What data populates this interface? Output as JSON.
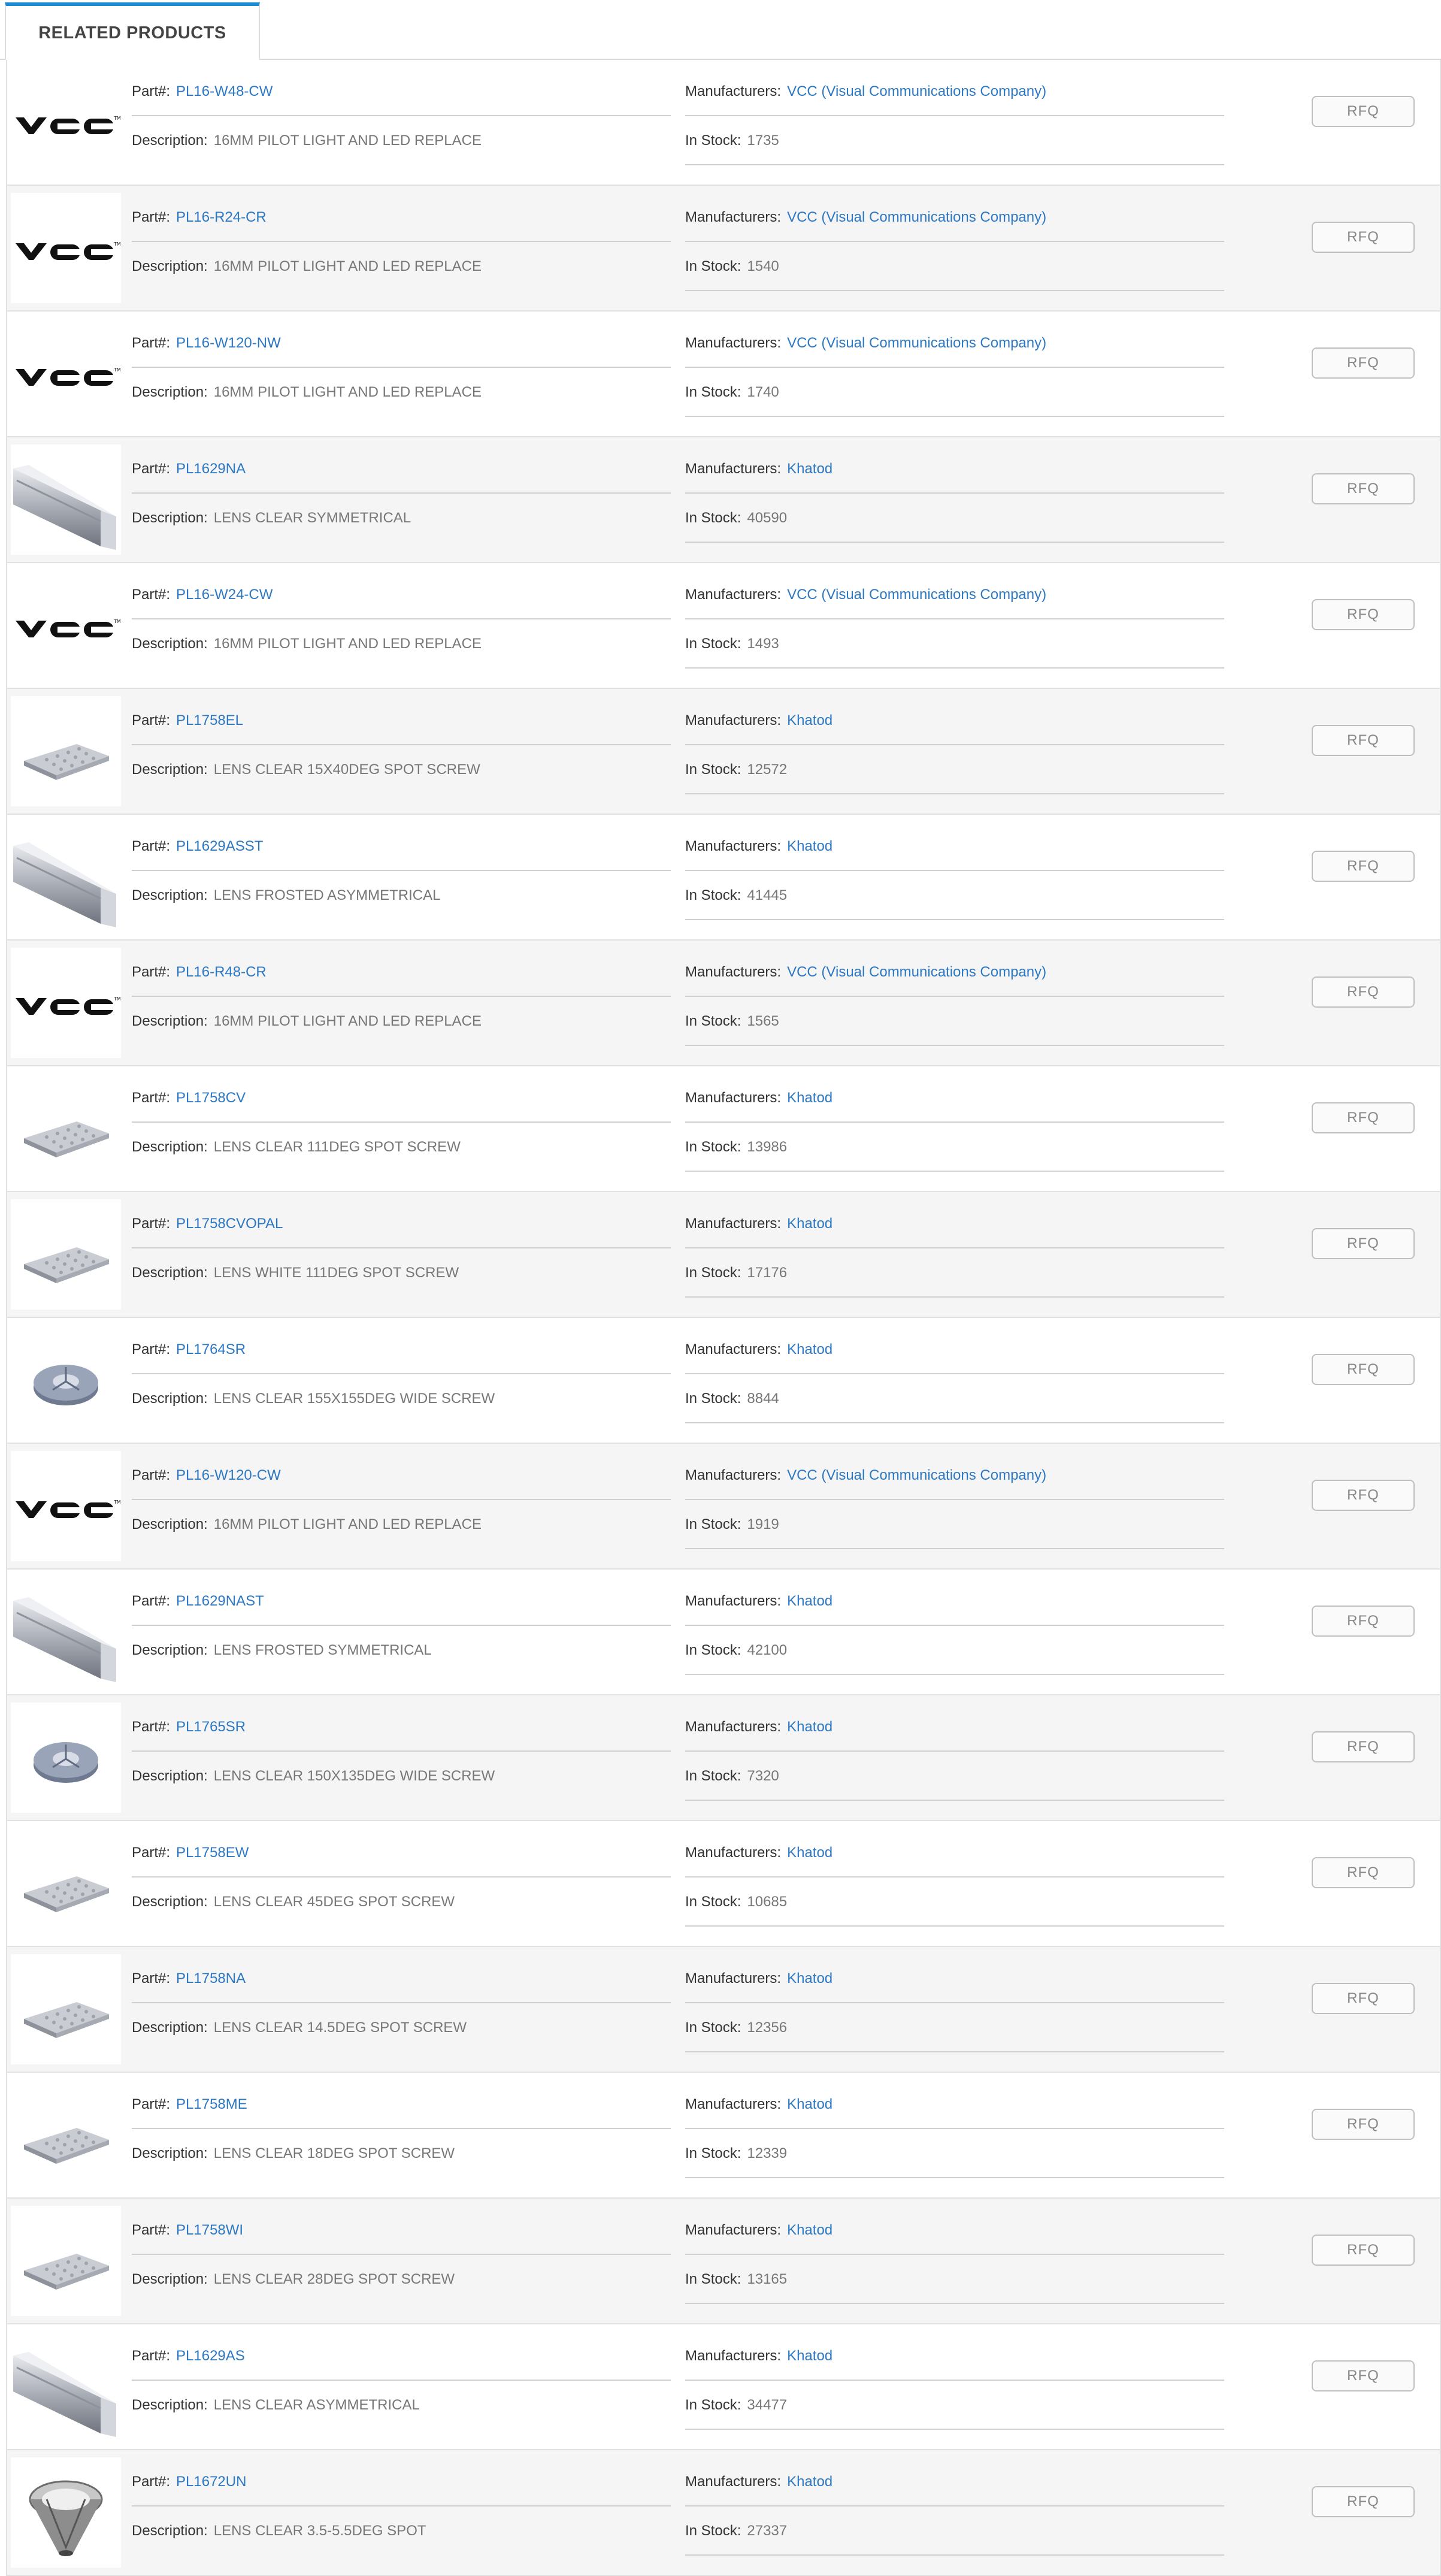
{
  "tab": {
    "label": "RELATED PRODUCTS"
  },
  "labels": {
    "part": "Part#:",
    "description": "Description:",
    "manufacturers": "Manufacturers:",
    "in_stock": "In Stock:",
    "rfq": "RFQ"
  },
  "products": [
    {
      "part": "PL16-W48-CW",
      "description": "16MM PILOT LIGHT AND LED REPLACE",
      "manufacturer": "VCC (Visual Communications Company)",
      "stock": "1735",
      "image": "vcc-logo"
    },
    {
      "part": "PL16-R24-CR",
      "description": "16MM PILOT LIGHT AND LED REPLACE",
      "manufacturer": "VCC (Visual Communications Company)",
      "stock": "1540",
      "image": "vcc-logo"
    },
    {
      "part": "PL16-W120-NW",
      "description": "16MM PILOT LIGHT AND LED REPLACE",
      "manufacturer": "VCC (Visual Communications Company)",
      "stock": "1740",
      "image": "vcc-logo"
    },
    {
      "part": "PL1629NA",
      "description": "LENS CLEAR SYMMETRICAL",
      "manufacturer": "Khatod",
      "stock": "40590",
      "image": "profile"
    },
    {
      "part": "PL16-W24-CW",
      "description": "16MM PILOT LIGHT AND LED REPLACE",
      "manufacturer": "VCC (Visual Communications Company)",
      "stock": "1493",
      "image": "vcc-logo"
    },
    {
      "part": "PL1758EL",
      "description": "LENS CLEAR 15X40DEG SPOT SCREW",
      "manufacturer": "Khatod",
      "stock": "12572",
      "image": "panel"
    },
    {
      "part": "PL1629ASST",
      "description": "LENS FROSTED ASYMMETRICAL",
      "manufacturer": "Khatod",
      "stock": "41445",
      "image": "profile"
    },
    {
      "part": "PL16-R48-CR",
      "description": "16MM PILOT LIGHT AND LED REPLACE",
      "manufacturer": "VCC (Visual Communications Company)",
      "stock": "1565",
      "image": "vcc-logo"
    },
    {
      "part": "PL1758CV",
      "description": "LENS CLEAR 111DEG SPOT SCREW",
      "manufacturer": "Khatod",
      "stock": "13986",
      "image": "panel"
    },
    {
      "part": "PL1758CVOPAL",
      "description": "LENS WHITE 111DEG SPOT SCREW",
      "manufacturer": "Khatod",
      "stock": "17176",
      "image": "panel"
    },
    {
      "part": "PL1764SR",
      "description": "LENS CLEAR 155X155DEG WIDE SCREW",
      "manufacturer": "Khatod",
      "stock": "8844",
      "image": "round-lens"
    },
    {
      "part": "PL16-W120-CW",
      "description": "16MM PILOT LIGHT AND LED REPLACE",
      "manufacturer": "VCC (Visual Communications Company)",
      "stock": "1919",
      "image": "vcc-logo"
    },
    {
      "part": "PL1629NAST",
      "description": "LENS FROSTED SYMMETRICAL",
      "manufacturer": "Khatod",
      "stock": "42100",
      "image": "profile"
    },
    {
      "part": "PL1765SR",
      "description": "LENS CLEAR 150X135DEG WIDE SCREW",
      "manufacturer": "Khatod",
      "stock": "7320",
      "image": "round-lens"
    },
    {
      "part": "PL1758EW",
      "description": "LENS CLEAR 45DEG SPOT SCREW",
      "manufacturer": "Khatod",
      "stock": "10685",
      "image": "panel"
    },
    {
      "part": "PL1758NA",
      "description": "LENS CLEAR 14.5DEG SPOT SCREW",
      "manufacturer": "Khatod",
      "stock": "12356",
      "image": "panel"
    },
    {
      "part": "PL1758ME",
      "description": "LENS CLEAR 18DEG SPOT SCREW",
      "manufacturer": "Khatod",
      "stock": "12339",
      "image": "panel"
    },
    {
      "part": "PL1758WI",
      "description": "LENS CLEAR 28DEG SPOT SCREW",
      "manufacturer": "Khatod",
      "stock": "13165",
      "image": "panel"
    },
    {
      "part": "PL1629AS",
      "description": "LENS CLEAR ASYMMETRICAL",
      "manufacturer": "Khatod",
      "stock": "34477",
      "image": "profile"
    },
    {
      "part": "PL1672UN",
      "description": "LENS CLEAR 3.5-5.5DEG SPOT",
      "manufacturer": "Khatod",
      "stock": "27337",
      "image": "cone-lens"
    }
  ],
  "colors": {
    "link": "#2d78c2",
    "tab_accent": "#1a8bd6",
    "row_alt": "#f5f5f5"
  }
}
